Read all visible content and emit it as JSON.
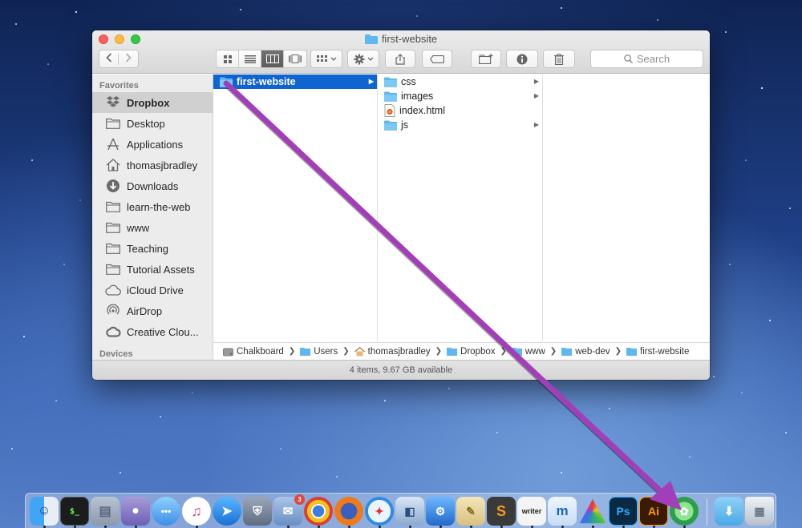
{
  "window": {
    "title": "first-website",
    "search_placeholder": "Search"
  },
  "sidebar": {
    "favorites_heading": "Favorites",
    "devices_heading": "Devices",
    "items": [
      {
        "label": "Dropbox",
        "icon": "dropbox-icon"
      },
      {
        "label": "Desktop",
        "icon": "folder-icon"
      },
      {
        "label": "Applications",
        "icon": "applications-icon"
      },
      {
        "label": "thomasjbradley",
        "icon": "home-icon"
      },
      {
        "label": "Downloads",
        "icon": "downloads-icon"
      },
      {
        "label": "learn-the-web",
        "icon": "folder-icon"
      },
      {
        "label": "www",
        "icon": "folder-icon"
      },
      {
        "label": "Teaching",
        "icon": "folder-icon"
      },
      {
        "label": "Tutorial Assets",
        "icon": "folder-icon"
      },
      {
        "label": "iCloud Drive",
        "icon": "cloud-icon"
      },
      {
        "label": "AirDrop",
        "icon": "airdrop-icon"
      },
      {
        "label": "Creative Clou...",
        "icon": "creative-cloud-icon"
      }
    ]
  },
  "columns": {
    "col1": [
      {
        "label": "first-website",
        "type": "folder",
        "has_children": true
      }
    ],
    "col2": [
      {
        "label": "css",
        "type": "folder",
        "has_children": true
      },
      {
        "label": "images",
        "type": "folder",
        "has_children": true
      },
      {
        "label": "index.html",
        "type": "html-file",
        "has_children": false
      },
      {
        "label": "js",
        "type": "folder",
        "has_children": true
      }
    ]
  },
  "pathbar": [
    "Chalkboard",
    "Users",
    "thomasjbradley",
    "Dropbox",
    "www",
    "web-dev",
    "first-website"
  ],
  "status": "4 items, 9.67 GB available",
  "dock": {
    "mail_badge": "3"
  },
  "colors": {
    "selection": "#0f64d2",
    "annotation_arrow": "#a23fb8",
    "folder": "#5db7f0"
  }
}
